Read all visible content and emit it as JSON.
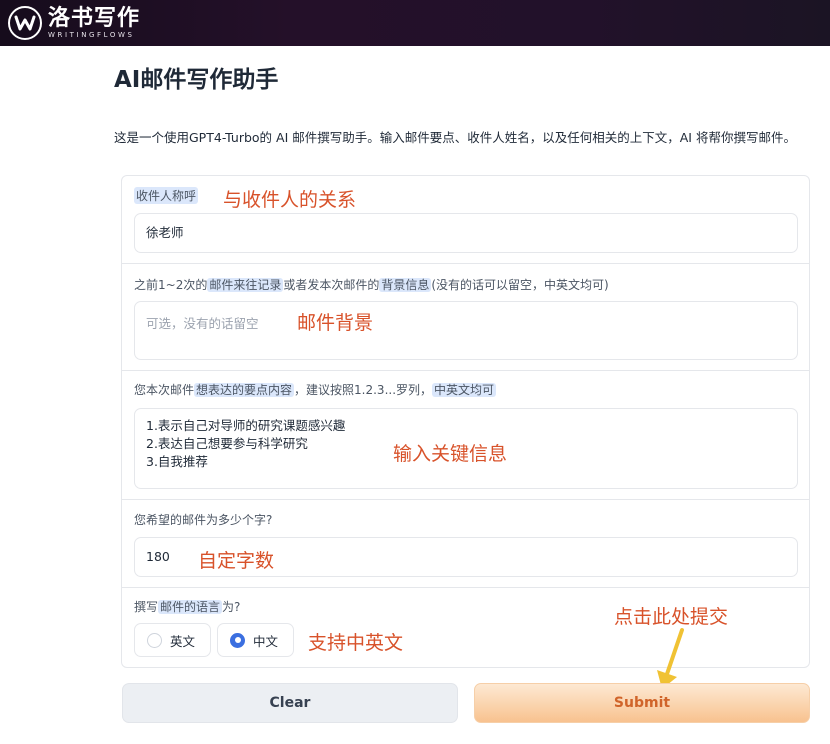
{
  "brand": {
    "name_cn": "洛书写作",
    "name_en": "WRITINGFLOWS"
  },
  "page": {
    "title": "AI邮件写作助手",
    "description": "这是一个使用GPT4-Turbo的 AI 邮件撰写助手。输入邮件要点、收件人姓名，以及任何相关的上下文，AI 将帮你撰写邮件。"
  },
  "form": {
    "recipient": {
      "label": "收件人称呼",
      "value": "徐老师",
      "annotation": "与收件人的关系"
    },
    "background": {
      "label_parts": [
        "之前1~2次的",
        "邮件来往记录",
        "或者发本次邮件的",
        "背景信息",
        "(没有的话可以留空，中英文均可)"
      ],
      "placeholder": "可选，没有的话留空",
      "annotation": "邮件背景"
    },
    "points": {
      "label_parts": [
        "您本次邮件",
        "想表达的要点内容",
        "，建议按照1.2.3...罗列，",
        "中英文均可"
      ],
      "lines": [
        "1.表示自己对导师的研究课题感兴趣",
        "2.表达自己想要参与科学研究",
        "3.自我推荐"
      ],
      "annotation": "输入关键信息"
    },
    "length": {
      "label": "您希望的邮件为多少个字?",
      "value": "180",
      "annotation": "自定字数"
    },
    "language": {
      "label_parts": [
        "撰写",
        "邮件的语言",
        "为?"
      ],
      "options": [
        "英文",
        "中文"
      ],
      "selected": "中文",
      "annotation": "支持中英文"
    }
  },
  "actions": {
    "clear_label": "Clear",
    "submit_label": "Submit",
    "submit_annotation": "点击此处提交"
  },
  "colors": {
    "annotation": "#d8522a",
    "arrow": "#f0c234",
    "radio_selected": "#3b6fe0",
    "submit_text": "#d0642a"
  }
}
